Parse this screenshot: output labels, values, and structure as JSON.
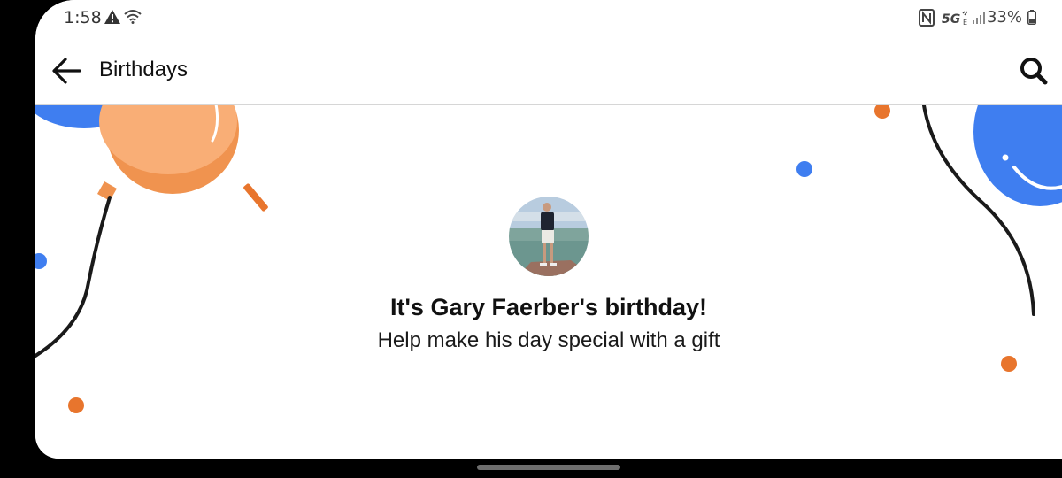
{
  "status_bar": {
    "time": "1:58",
    "left_icons": [
      "warning-icon",
      "wifi-icon"
    ],
    "right_icons": [
      "nfc-icon",
      "network-5g-icon",
      "signal-icon",
      "battery-icon"
    ],
    "network_label": "5G",
    "battery_percent": "33%"
  },
  "app_bar": {
    "title": "Birthdays",
    "back_icon": "arrow-left-icon",
    "search_icon": "search-icon"
  },
  "birthday": {
    "title": "It's Gary Faerber's birthday!",
    "subtitle": "Help make his day special with a gift"
  },
  "colors": {
    "balloon_orange": "#F9AE76",
    "balloon_orange_dark": "#F0934F",
    "balloon_blue": "#3F7EF0",
    "confetti_orange": "#E8752D",
    "string": "#1a1a1a",
    "divider": "#d6d6d6"
  }
}
